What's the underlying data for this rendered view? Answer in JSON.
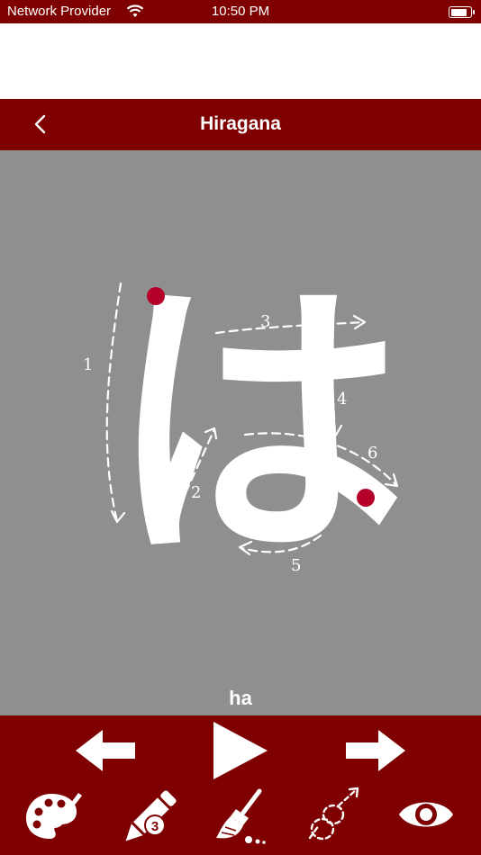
{
  "status_bar": {
    "carrier": "Network Provider",
    "time": "10:50 PM",
    "battery_level": 0.9
  },
  "nav": {
    "title": "Hiragana",
    "back_icon": "chevron-left-icon"
  },
  "character": {
    "kana": "は",
    "romaji": "ha",
    "stroke_numbers": [
      "1",
      "2",
      "3",
      "4",
      "5",
      "6"
    ]
  },
  "controls": {
    "prev_icon": "arrow-left-icon",
    "play_icon": "play-icon",
    "next_icon": "arrow-right-icon",
    "tools": [
      "palette-icon",
      "pencil-icon",
      "broom-icon",
      "stroke-path-icon",
      "eye-icon"
    ],
    "pencil_badge": "3"
  },
  "colors": {
    "brand": "#7f0000",
    "canvas": "#8f8f8f",
    "start_dot": "#b5002a",
    "glyph": "#ffffff"
  }
}
